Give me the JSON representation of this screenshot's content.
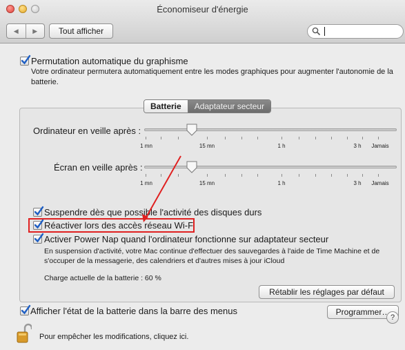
{
  "window": {
    "title": "Économiseur d'énergie"
  },
  "toolbar": {
    "show_all_label": "Tout afficher",
    "back_glyph": "◀",
    "forward_glyph": "▶"
  },
  "search": {
    "value": "",
    "placeholder": ""
  },
  "graphics_switching": {
    "checked": true,
    "label": "Permutation automatique du graphisme",
    "description": "Votre ordinateur permutera automatiquement entre les modes graphiques pour augmenter l'autonomie de la batterie."
  },
  "tabs": [
    {
      "label": "Batterie",
      "selected": false
    },
    {
      "label": "Adaptateur secteur",
      "selected": true
    }
  ],
  "computer_sleep": {
    "label": "Ordinateur en veille après :",
    "value_minutes": 15,
    "ticks": [
      "1 mn",
      "15 mn",
      "1 h",
      "3 h",
      "Jamais"
    ]
  },
  "display_sleep": {
    "label": "Écran en veille après :",
    "value_minutes": 15,
    "ticks": [
      "1 mn",
      "15 mn",
      "1 h",
      "3 h",
      "Jamais"
    ]
  },
  "options": [
    {
      "label": "Suspendre dès que possible l'activité des disques durs",
      "checked": true
    },
    {
      "label": "Réactiver lors des accès réseau Wi-Fi",
      "checked": true
    },
    {
      "label": "Activer Power Nap quand l'ordinateur fonctionne sur adaptateur secteur",
      "checked": true
    }
  ],
  "power_nap_description": "En suspension d'activité, votre Mac continue d'effectuer des sauvegardes à l'aide de Time Machine et de s'occuper de la messagerie, des calendriers et d'autres mises à jour iCloud",
  "battery_charge": "Charge actuelle de la batterie : 60 %",
  "restore_defaults_label": "Rétablir les réglages par défaut",
  "show_battery_status": {
    "checked": true,
    "label": "Afficher l'état de la batterie dans la barre des menus"
  },
  "schedule_label": "Programmer…",
  "lock_text": "Pour empêcher les modifications, cliquez ici.",
  "help_glyph": "?",
  "colors": {
    "highlight": "#e02020",
    "checkmark": "#1f5fc4",
    "selected_tab": "#7a7a7a"
  }
}
